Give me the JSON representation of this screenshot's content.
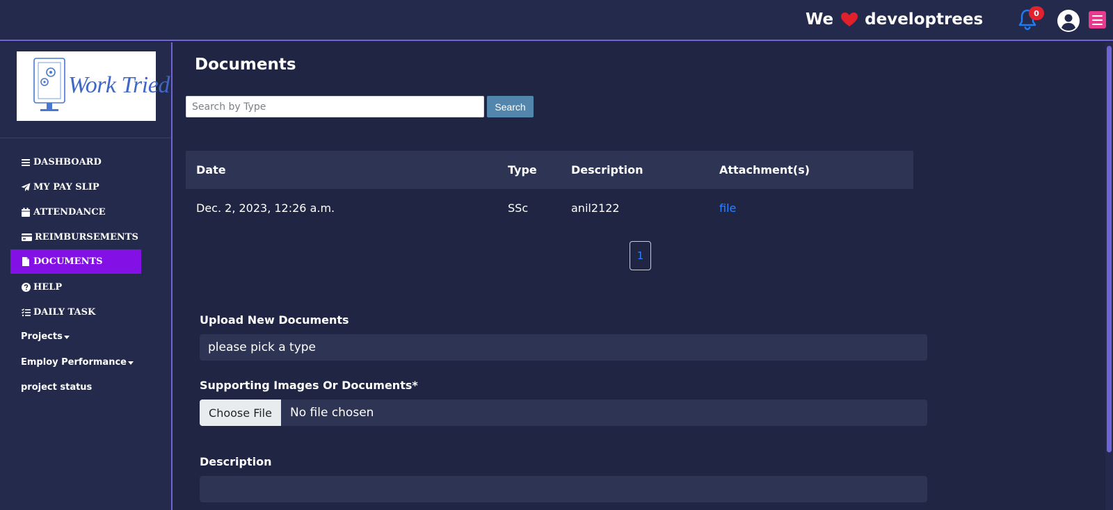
{
  "header": {
    "brand_prefix": "We",
    "brand_name": "developtrees",
    "notification_count": "0",
    "icons": [
      "heart-icon",
      "bell-icon",
      "user-circle-icon",
      "menu-icon"
    ],
    "accent_color": "#e93b8e"
  },
  "sidebar": {
    "logo_text": "Work Tried",
    "active_color": "#8311e6",
    "items": [
      {
        "label": "DASHBOARD",
        "icon": "bars-icon"
      },
      {
        "label": "MY PAY SLIP",
        "icon": "paper-plane-icon"
      },
      {
        "label": "ATTENDANCE",
        "icon": "calendar-icon"
      },
      {
        "label": "REIMBURSEMENTS",
        "icon": "credit-card-icon"
      },
      {
        "label": "DOCUMENTS",
        "icon": "file-icon"
      },
      {
        "label": "HELP",
        "icon": "question-circle-icon"
      },
      {
        "label": "DAILY TASK",
        "icon": "list-check-icon"
      },
      {
        "label": "Projects",
        "icon": "caret-down-icon"
      },
      {
        "label": "Employ Performance",
        "icon": "caret-down-icon"
      },
      {
        "label": "project status",
        "icon": ""
      }
    ]
  },
  "main": {
    "title": "Documents",
    "search": {
      "placeholder": "Search by Type",
      "value": "",
      "button_label": "Search"
    },
    "table": {
      "columns": [
        "Date",
        "Type",
        "Description",
        "Attachment(s)"
      ],
      "rows": [
        {
          "date": "Dec. 2, 2023, 12:26 a.m.",
          "type": "SSc",
          "description": "anil2122",
          "attachment": "file"
        }
      ]
    },
    "pagination": {
      "current_page": "1"
    },
    "upload_form": {
      "type_label": "Upload New Documents",
      "type_value": "please pick a type",
      "file_label": "Supporting Images Or Documents*",
      "file_button": "Choose File",
      "file_status": "No file chosen",
      "description_label": "Description",
      "description_value": ""
    }
  }
}
